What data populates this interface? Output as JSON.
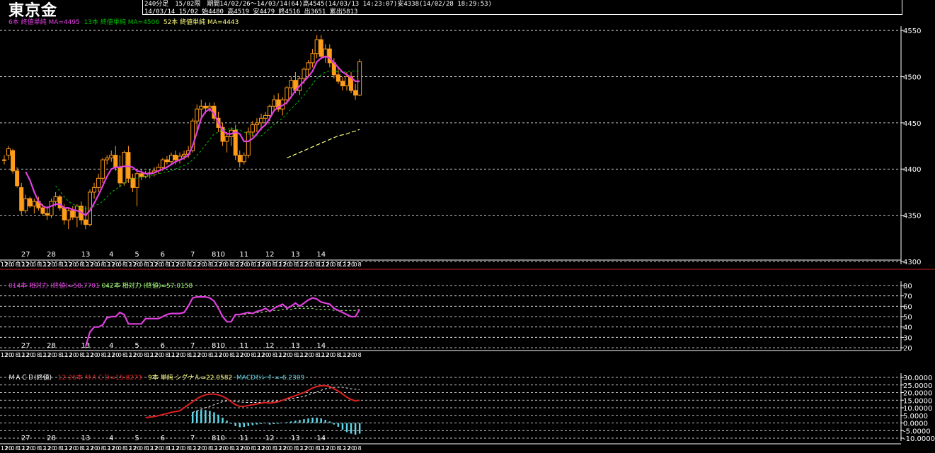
{
  "header": {
    "title": "東京金",
    "line1": "240分足　15/02限　期間14/02/26～14/03/14(64)高4545(14/03/13 14:23:07)安4338(14/02/28 18:29:53)",
    "line2": "14/03/14 15/02 始4480 高4519 安4479 終4516 出3651 累出5813"
  },
  "colors": {
    "background": "#000000",
    "candle": "#ff9c1a",
    "ma_short": "#e040e0",
    "ma_mid": "#00c000",
    "ma_long": "#ffff80",
    "rsi_short": "#e040e0",
    "rsi_long": "#a0ff70",
    "macd": "#e02020",
    "signal": "#ffffff",
    "osc": "#5fd7e8",
    "divider": "#c02020",
    "grid": "#ffffff"
  },
  "legends": {
    "price": [
      {
        "text": "6本 終値単純 MA=4495",
        "color": "#e040e0"
      },
      {
        "text": "13本 終値単純 MA=4506",
        "color": "#00c000"
      },
      {
        "text": "52本 終値単純 MA=4443",
        "color": "#ffff80"
      }
    ],
    "rsi": [
      {
        "text": "014本 相対力 (終値)=58.7701",
        "color": "#e040e0"
      },
      {
        "text": "042本 相対力 (終値)=57.0158",
        "color": "#a0ff70"
      }
    ],
    "macd": [
      {
        "text": "ＭＡＣＤ(終値)",
        "color": "#ffffff"
      },
      {
        "text": "12-26本 ＭＡＣＤ=15.8273",
        "color": "#e02020"
      },
      {
        "text": "9本 単純 シグナル=22.0582",
        "color": "#ffff80"
      },
      {
        "text": "MACDｵｼﾚｰﾀｰ=-6.2309",
        "color": "#5fd7e8"
      }
    ]
  },
  "chart_data": [
    {
      "type": "candlestick",
      "panel": "price",
      "ylim": [
        4300,
        4560
      ],
      "yticks": [
        4550,
        4500,
        4450,
        4400,
        4350,
        4300
      ],
      "date_labels": [
        "27",
        "28",
        "13",
        "4",
        "5",
        "6",
        "7",
        "810",
        "11",
        "12",
        "13",
        "14"
      ],
      "date_label_bars": [
        5,
        11,
        19,
        25,
        31,
        37,
        44,
        50,
        56,
        62,
        68,
        74
      ],
      "time_tick_labels": [
        "12",
        "20",
        "0",
        "8",
        "12"
      ],
      "ohlc": [
        [
          4410,
          4415,
          4405,
          4410
        ],
        [
          4415,
          4425,
          4410,
          4422
        ],
        [
          4420,
          4422,
          4395,
          4398
        ],
        [
          4398,
          4402,
          4380,
          4382
        ],
        [
          4380,
          4385,
          4350,
          4355
        ],
        [
          4355,
          4372,
          4352,
          4368
        ],
        [
          4368,
          4370,
          4358,
          4360
        ],
        [
          4360,
          4368,
          4352,
          4365
        ],
        [
          4365,
          4370,
          4355,
          4358
        ],
        [
          4358,
          4362,
          4350,
          4352
        ],
        [
          4352,
          4360,
          4345,
          4350
        ],
        [
          4350,
          4368,
          4347,
          4365
        ],
        [
          4365,
          4375,
          4360,
          4370
        ],
        [
          4370,
          4372,
          4355,
          4358
        ],
        [
          4358,
          4362,
          4340,
          4345
        ],
        [
          4345,
          4358,
          4335,
          4355
        ],
        [
          4355,
          4360,
          4345,
          4348
        ],
        [
          4348,
          4362,
          4337,
          4360
        ],
        [
          4360,
          4365,
          4340,
          4345
        ],
        [
          4345,
          4360,
          4335,
          4340
        ],
        [
          4340,
          4378,
          4338,
          4375
        ],
        [
          4375,
          4385,
          4368,
          4380
        ],
        [
          4380,
          4395,
          4375,
          4390
        ],
        [
          4390,
          4412,
          4385,
          4410
        ],
        [
          4410,
          4415,
          4405,
          4412
        ],
        [
          4412,
          4420,
          4408,
          4415
        ],
        [
          4415,
          4425,
          4398,
          4402
        ],
        [
          4402,
          4415,
          4380,
          4385
        ],
        [
          4385,
          4420,
          4382,
          4418
        ],
        [
          4418,
          4425,
          4385,
          4390
        ],
        [
          4390,
          4395,
          4375,
          4380
        ],
        [
          4380,
          4398,
          4360,
          4395
        ],
        [
          4395,
          4400,
          4388,
          4392
        ],
        [
          4392,
          4398,
          4390,
          4395
        ],
        [
          4395,
          4400,
          4390,
          4396
        ],
        [
          4396,
          4402,
          4392,
          4398
        ],
        [
          4398,
          4406,
          4395,
          4402
        ],
        [
          4402,
          4412,
          4398,
          4410
        ],
        [
          4410,
          4414,
          4405,
          4408
        ],
        [
          4408,
          4418,
          4404,
          4415
        ],
        [
          4415,
          4420,
          4405,
          4410
        ],
        [
          4410,
          4418,
          4406,
          4414
        ],
        [
          4414,
          4420,
          4410,
          4416
        ],
        [
          4416,
          4425,
          4412,
          4420
        ],
        [
          4420,
          4455,
          4418,
          4452
        ],
        [
          4452,
          4470,
          4440,
          4465
        ],
        [
          4465,
          4475,
          4455,
          4468
        ],
        [
          4468,
          4472,
          4460,
          4466
        ],
        [
          4466,
          4472,
          4462,
          4468
        ],
        [
          4468,
          4472,
          4452,
          4455
        ],
        [
          4455,
          4462,
          4440,
          4445
        ],
        [
          4445,
          4450,
          4425,
          4430
        ],
        [
          4430,
          4440,
          4418,
          4435
        ],
        [
          4435,
          4445,
          4425,
          4442
        ],
        [
          4442,
          4448,
          4410,
          4415
        ],
        [
          4415,
          4420,
          4402,
          4408
        ],
        [
          4408,
          4418,
          4405,
          4415
        ],
        [
          4415,
          4445,
          4412,
          4440
        ],
        [
          4440,
          4452,
          4435,
          4448
        ],
        [
          4448,
          4455,
          4440,
          4450
        ],
        [
          4450,
          4460,
          4442,
          4455
        ],
        [
          4455,
          4462,
          4448,
          4458
        ],
        [
          4458,
          4470,
          4452,
          4468
        ],
        [
          4468,
          4480,
          4462,
          4475
        ],
        [
          4475,
          4482,
          4462,
          4465
        ],
        [
          4465,
          4478,
          4458,
          4475
        ],
        [
          4475,
          4490,
          4470,
          4488
        ],
        [
          4488,
          4500,
          4480,
          4496
        ],
        [
          4496,
          4505,
          4482,
          4485
        ],
        [
          4485,
          4500,
          4480,
          4498
        ],
        [
          4498,
          4510,
          4492,
          4508
        ],
        [
          4508,
          4518,
          4500,
          4515
        ],
        [
          4515,
          4530,
          4510,
          4525
        ],
        [
          4525,
          4545,
          4520,
          4540
        ],
        [
          4540,
          4545,
          4520,
          4522
        ],
        [
          4522,
          4535,
          4515,
          4530
        ],
        [
          4530,
          4535,
          4510,
          4515
        ],
        [
          4515,
          4520,
          4498,
          4502
        ],
        [
          4502,
          4510,
          4492,
          4495
        ],
        [
          4495,
          4500,
          4485,
          4490
        ],
        [
          4490,
          4505,
          4485,
          4500
        ],
        [
          4500,
          4505,
          4482,
          4485
        ],
        [
          4485,
          4492,
          4475,
          4480
        ],
        [
          4480,
          4519,
          4479,
          4516
        ]
      ],
      "ma_short": [
        null,
        null,
        null,
        null,
        null,
        4397,
        4388,
        4375,
        4365,
        4360,
        4358,
        4360,
        4362,
        4362,
        4358,
        4358,
        4356,
        4355,
        4353,
        4350,
        4355,
        4363,
        4372,
        4382,
        4392,
        4400,
        4402,
        4402,
        4403,
        4403,
        4402,
        4398,
        4397,
        4395,
        4395,
        4396,
        4398,
        4400,
        4402,
        4405,
        4408,
        4410,
        4412,
        4415,
        4425,
        4440,
        4455,
        4462,
        4465,
        4460,
        4450,
        4442,
        4438,
        4438,
        4440,
        4438,
        4430,
        4430,
        4433,
        4438,
        4444,
        4448,
        4455,
        4463,
        4467,
        4469,
        4472,
        4478,
        4485,
        4490,
        4495,
        4500,
        4506,
        4516,
        4520,
        4522,
        4520,
        4515,
        4510,
        4505,
        4502,
        4499,
        4495,
        4495
      ],
      "ma_mid": [
        null,
        null,
        null,
        null,
        null,
        null,
        null,
        null,
        null,
        null,
        null,
        null,
        4382,
        4376,
        4370,
        4365,
        4362,
        4360,
        4358,
        4357,
        4358,
        4360,
        4362,
        4365,
        4370,
        4375,
        4378,
        4381,
        4385,
        4388,
        4390,
        4390,
        4391,
        4392,
        4393,
        4394,
        4395,
        4396,
        4397,
        4398,
        4400,
        4402,
        4404,
        4406,
        4410,
        4415,
        4420,
        4426,
        4432,
        4438,
        4440,
        4442,
        4443,
        4444,
        4443,
        4442,
        4440,
        4438,
        4437,
        4436,
        4436,
        4440,
        4444,
        4448,
        4452,
        4455,
        4460,
        4465,
        4470,
        4475,
        4480,
        4486,
        4492,
        4498,
        4502,
        4505,
        4506,
        4506,
        4505,
        4505,
        4505,
        4506,
        4506,
        4506
      ],
      "ma_long": [
        null,
        null,
        null,
        null,
        null,
        null,
        null,
        null,
        null,
        null,
        null,
        null,
        null,
        null,
        null,
        null,
        null,
        null,
        null,
        null,
        null,
        null,
        null,
        null,
        null,
        null,
        null,
        null,
        null,
        null,
        null,
        null,
        null,
        null,
        null,
        null,
        null,
        null,
        null,
        null,
        null,
        null,
        null,
        null,
        null,
        null,
        null,
        null,
        null,
        null,
        null,
        null,
        null,
        null,
        null,
        null,
        null,
        null,
        null,
        null,
        null,
        null,
        null,
        null,
        null,
        null,
        4412,
        4414,
        4416,
        4418,
        4420,
        4422,
        4424,
        4426,
        4428,
        4430,
        4432,
        4434,
        4436,
        4437,
        4438,
        4440,
        4441,
        4443
      ]
    },
    {
      "type": "line",
      "panel": "rsi",
      "ylim": [
        20,
        80
      ],
      "yticks": [
        80,
        70,
        60,
        50,
        40,
        30,
        20
      ],
      "date_labels": [
        "27",
        "28",
        "13",
        "4",
        "5",
        "6",
        "7",
        "810",
        "11",
        "12",
        "13",
        "14"
      ],
      "rsi_short": [
        null,
        null,
        null,
        null,
        null,
        null,
        null,
        null,
        null,
        null,
        null,
        null,
        null,
        null,
        null,
        null,
        null,
        null,
        null,
        21,
        35,
        40,
        40,
        42,
        49,
        50,
        50,
        54,
        52,
        43,
        43,
        43,
        43,
        48,
        48,
        48,
        48,
        50,
        52,
        53,
        53,
        53,
        54,
        60,
        68,
        69,
        69,
        69,
        68,
        65,
        58,
        50,
        45,
        45,
        52,
        52,
        53,
        54,
        53,
        55,
        56,
        58,
        55,
        58,
        60,
        62,
        58,
        60,
        63,
        60,
        63,
        66,
        68,
        67,
        64,
        63,
        62,
        58,
        56,
        54,
        52,
        50,
        50,
        57
      ],
      "rsi_long": [
        null,
        null,
        null,
        null,
        null,
        null,
        null,
        null,
        null,
        null,
        null,
        null,
        null,
        null,
        null,
        null,
        null,
        null,
        null,
        null,
        null,
        null,
        null,
        null,
        null,
        null,
        null,
        null,
        null,
        null,
        null,
        null,
        null,
        null,
        null,
        null,
        null,
        null,
        null,
        null,
        null,
        null,
        null,
        null,
        null,
        null,
        null,
        null,
        null,
        null,
        null,
        null,
        null,
        null,
        null,
        null,
        52,
        53,
        53,
        54,
        54,
        55,
        55,
        56,
        56,
        57,
        57,
        57,
        58,
        58,
        58,
        58,
        58,
        57,
        57,
        57,
        57,
        56,
        56,
        56,
        56,
        56,
        56,
        57
      ]
    },
    {
      "type": "line+bar",
      "panel": "macd",
      "ylim": [
        -10,
        30
      ],
      "yticks": [
        30,
        25,
        20,
        15,
        10,
        5,
        0,
        -5,
        -10
      ],
      "ytick_labels": [
        "30.0000",
        "25.0000",
        "20.0000",
        "15.0000",
        "10.0000",
        "5.0000",
        "0.0000",
        "-5.0000",
        "-10.0000"
      ],
      "date_labels": [
        "27",
        "28",
        "13",
        "4",
        "5",
        "6",
        "7",
        "810",
        "11",
        "12",
        "13",
        "14"
      ],
      "macd": [
        null,
        null,
        null,
        null,
        null,
        null,
        null,
        null,
        null,
        null,
        null,
        null,
        null,
        null,
        null,
        null,
        null,
        null,
        null,
        null,
        null,
        null,
        null,
        null,
        null,
        null,
        null,
        null,
        null,
        null,
        null,
        null,
        null,
        3.5,
        3.8,
        4.2,
        4.8,
        5.5,
        6.2,
        7.0,
        7.5,
        8.0,
        10,
        12,
        14,
        16,
        17.5,
        18.5,
        19,
        19,
        18.5,
        17.5,
        16,
        14,
        12,
        11,
        11,
        11.5,
        12,
        12.5,
        13,
        13.5,
        13,
        13.5,
        14,
        15,
        16,
        17,
        18,
        19,
        20,
        21.5,
        23,
        24,
        24.5,
        24.5,
        24,
        22.5,
        21,
        19,
        17,
        15.5,
        14.5,
        15
      ],
      "signal": [
        null,
        null,
        null,
        null,
        null,
        null,
        null,
        null,
        null,
        null,
        null,
        null,
        null,
        null,
        null,
        null,
        null,
        null,
        null,
        null,
        null,
        null,
        null,
        null,
        null,
        null,
        null,
        null,
        null,
        null,
        null,
        null,
        null,
        null,
        null,
        null,
        null,
        null,
        null,
        null,
        null,
        null,
        null,
        null,
        7,
        8,
        9,
        10,
        11,
        12,
        13,
        14,
        14.5,
        14.5,
        14,
        13.8,
        13.6,
        13.5,
        13.5,
        13.5,
        13.6,
        13.8,
        14,
        14.2,
        14.5,
        15,
        15.5,
        16,
        16.5,
        17,
        17.5,
        18.5,
        19.5,
        20.5,
        21.5,
        22.5,
        23,
        23.5,
        23.5,
        23.5,
        23,
        22.5,
        22.2,
        22
      ],
      "oscillator": [
        null,
        null,
        null,
        null,
        null,
        null,
        null,
        null,
        null,
        null,
        null,
        null,
        null,
        null,
        null,
        null,
        null,
        null,
        null,
        null,
        null,
        null,
        null,
        null,
        null,
        null,
        null,
        null,
        null,
        null,
        null,
        null,
        null,
        null,
        null,
        null,
        null,
        null,
        null,
        null,
        null,
        null,
        null,
        null,
        7,
        8,
        8.5,
        8.5,
        8,
        7,
        5.5,
        3.5,
        1.5,
        -0.5,
        -2,
        -2.8,
        -2.6,
        -2,
        -1.5,
        -1,
        -0.6,
        -0.3,
        -1,
        -0.7,
        -0.5,
        0,
        0.5,
        1,
        1.5,
        2,
        2.5,
        3,
        3.5,
        3.5,
        3,
        2,
        1,
        -1,
        -2.5,
        -4.5,
        -6,
        -7,
        -7.7,
        -7
      ]
    }
  ]
}
